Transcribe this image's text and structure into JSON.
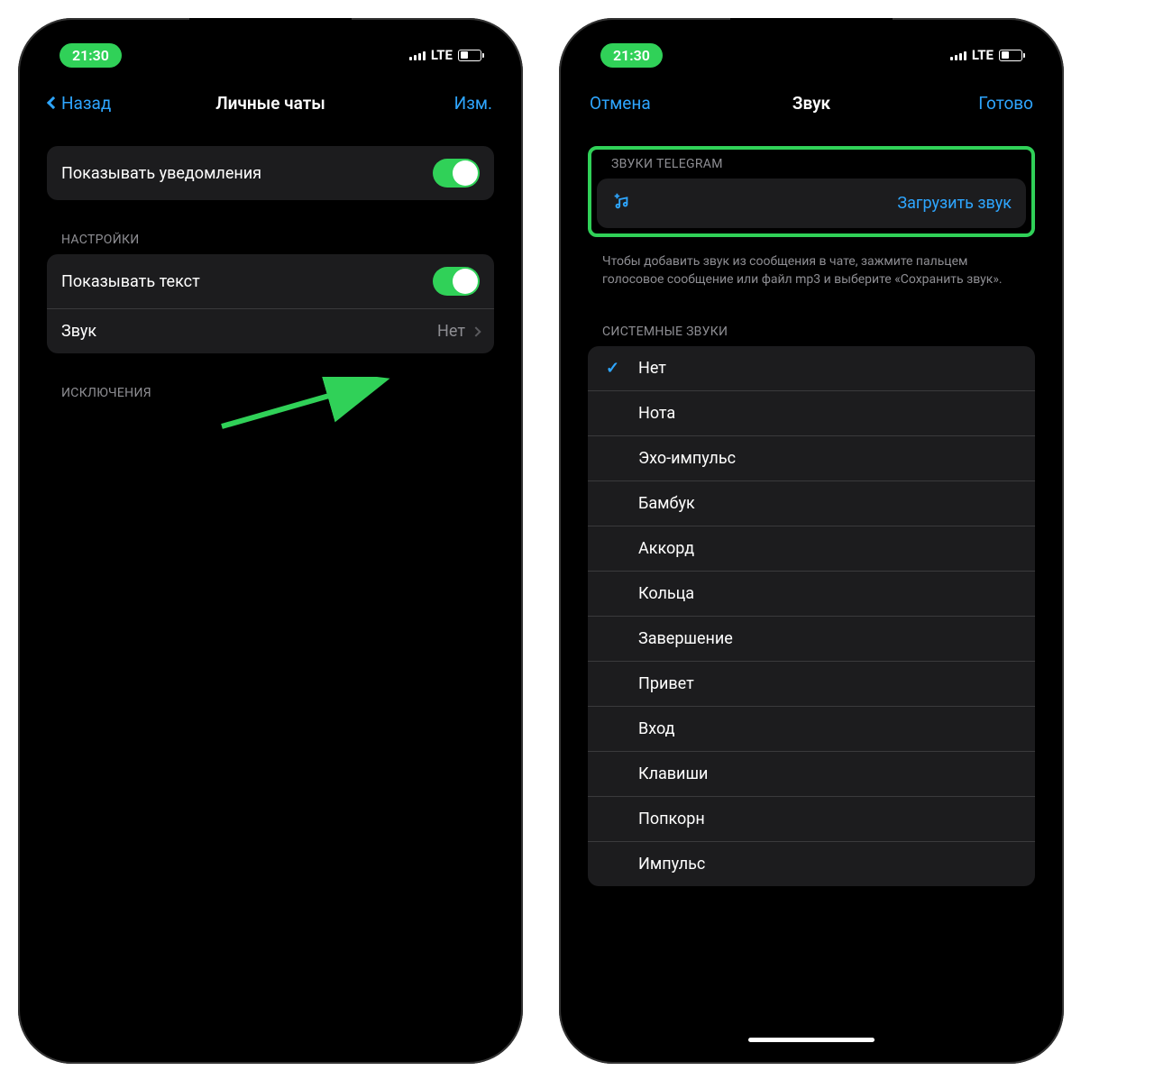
{
  "status": {
    "time": "21:30",
    "network": "LTE"
  },
  "left": {
    "nav": {
      "back": "Назад",
      "title": "Личные чаты",
      "edit": "Изм."
    },
    "show_notifications": "Показывать уведомления",
    "settings_header": "НАСТРОЙКИ",
    "show_text": "Показывать текст",
    "sound_label": "Звук",
    "sound_value": "Нет",
    "exceptions_header": "ИСКЛЮЧЕНИЯ"
  },
  "right": {
    "nav": {
      "cancel": "Отмена",
      "title": "Звук",
      "done": "Готово"
    },
    "telegram_sounds_header": "ЗВУКИ TELEGRAM",
    "upload_label": "Загрузить звук",
    "upload_hint": "Чтобы добавить звук из сообщения в чате, зажмите пальцем голосовое сообщение или файл mp3 и выберите «Сохранить звук».",
    "system_sounds_header": "СИСТЕМНЫЕ ЗВУКИ",
    "sounds": [
      {
        "label": "Нет",
        "selected": true
      },
      {
        "label": "Нота",
        "selected": false
      },
      {
        "label": "Эхо-импульс",
        "selected": false
      },
      {
        "label": "Бамбук",
        "selected": false
      },
      {
        "label": "Аккорд",
        "selected": false
      },
      {
        "label": "Кольца",
        "selected": false
      },
      {
        "label": "Завершение",
        "selected": false
      },
      {
        "label": "Привет",
        "selected": false
      },
      {
        "label": "Вход",
        "selected": false
      },
      {
        "label": "Клавиши",
        "selected": false
      },
      {
        "label": "Попкорн",
        "selected": false
      },
      {
        "label": "Импульс",
        "selected": false
      }
    ]
  }
}
